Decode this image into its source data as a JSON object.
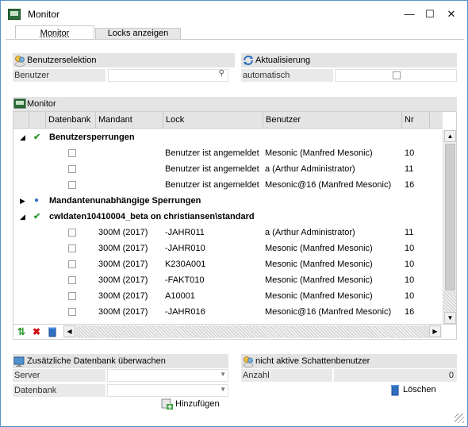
{
  "window": {
    "title": "Monitor",
    "minimize": "—",
    "maximize": "☐",
    "close": "✕"
  },
  "tabs": [
    {
      "label": "Monitor",
      "active": true
    },
    {
      "label": "Locks anzeigen",
      "active": false
    }
  ],
  "user_selection": {
    "header": "Benutzerselektion",
    "field_label": "Benutzer",
    "value": ""
  },
  "refresh": {
    "header": "Aktualisierung",
    "field_label": "automatisch",
    "checked": false
  },
  "monitor": {
    "header": "Monitor",
    "columns": [
      "Datenbank",
      "Mandant",
      "Lock",
      "Benutzer",
      "Nr"
    ],
    "groups": [
      {
        "title": "Benutzersperrungen",
        "expanded": true,
        "icon": "check-icon",
        "rows": [
          {
            "mandant": "",
            "lock": "Benutzer ist angemeldet",
            "benutzer": "Mesonic (Manfred Mesonic)",
            "nr": "10"
          },
          {
            "mandant": "",
            "lock": "Benutzer ist angemeldet",
            "benutzer": "a (Arthur Administrator)",
            "nr": "11"
          },
          {
            "mandant": "",
            "lock": "Benutzer ist angemeldet",
            "benutzer": "Mesonic@16 (Manfred Mesonic)",
            "nr": "16"
          }
        ]
      },
      {
        "title": "Mandantenunabhängige Sperrungen",
        "expanded": false,
        "icon": "globe-icon",
        "rows": []
      },
      {
        "title": "cwldaten10410004_beta on christiansen\\standard",
        "expanded": true,
        "icon": "check-icon",
        "rows": [
          {
            "mandant": "300M (2017)",
            "lock": "-JAHR011",
            "benutzer": "a (Arthur Administrator)",
            "nr": "11"
          },
          {
            "mandant": "300M (2017)",
            "lock": "-JAHR010",
            "benutzer": "Mesonic (Manfred Mesonic)",
            "nr": "10"
          },
          {
            "mandant": "300M (2017)",
            "lock": "K230A001",
            "benutzer": "Mesonic (Manfred Mesonic)",
            "nr": "10"
          },
          {
            "mandant": "300M (2017)",
            "lock": "-FAKT010",
            "benutzer": "Mesonic (Manfred Mesonic)",
            "nr": "10"
          },
          {
            "mandant": "300M (2017)",
            "lock": "A10001",
            "benutzer": "Mesonic (Manfred Mesonic)",
            "nr": "10"
          },
          {
            "mandant": "300M (2017)",
            "lock": "-JAHR016",
            "benutzer": "Mesonic@16 (Manfred Mesonic)",
            "nr": "16"
          }
        ]
      }
    ]
  },
  "additional_db": {
    "header": "Zusätzliche Datenbank überwachen",
    "server_label": "Server",
    "database_label": "Datenbank",
    "add_button": "Hinzufügen"
  },
  "inactive_shadow": {
    "header": "nicht aktive Schattenbenutzer",
    "count_label": "Anzahl",
    "count_value": "0",
    "delete_button": "Löschen"
  }
}
